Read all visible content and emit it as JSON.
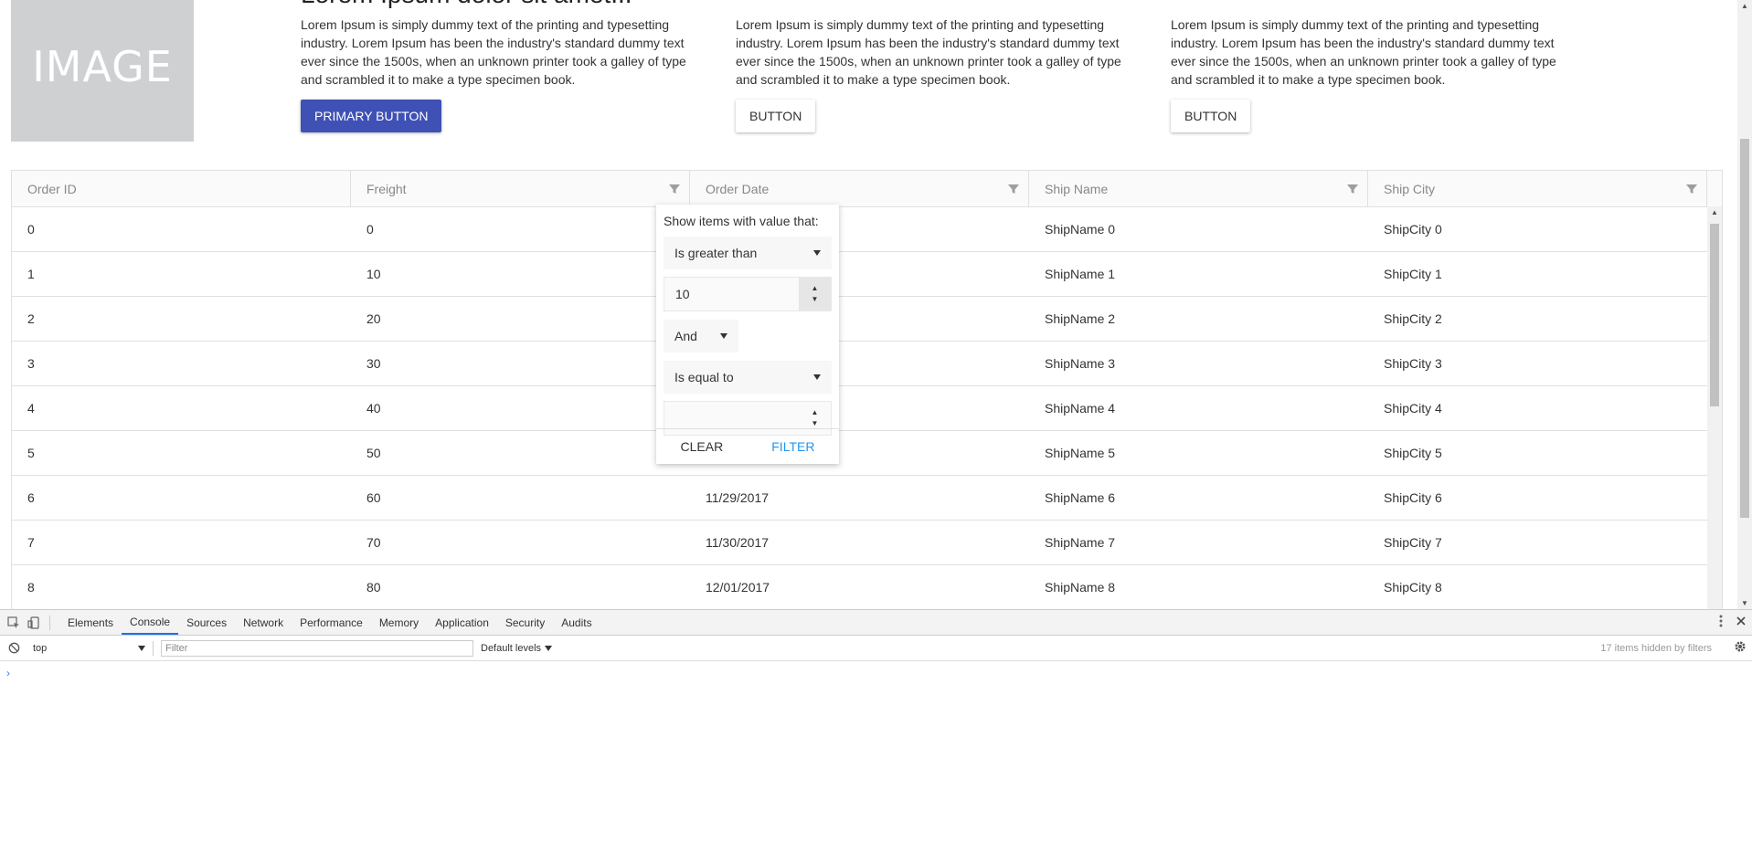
{
  "hero": {
    "image_placeholder": "IMAGE",
    "title": "Lorem Ipsum dolor sit amet...",
    "cards": [
      {
        "text": "Lorem Ipsum is simply dummy text of the printing and typesetting industry. Lorem Ipsum has been the industry's standard dummy text ever since the 1500s, when an unknown printer took a galley of type and scrambled it to make a type specimen book.",
        "button": "PRIMARY BUTTON"
      },
      {
        "text": "Lorem Ipsum is simply dummy text of the printing and typesetting industry. Lorem Ipsum has been the industry's standard dummy text ever since the 1500s, when an unknown printer took a galley of type and scrambled it to make a type specimen book.",
        "button": "BUTTON"
      },
      {
        "text": "Lorem Ipsum is simply dummy text of the printing and typesetting industry. Lorem Ipsum has been the industry's standard dummy text ever since the 1500s, when an unknown printer took a galley of type and scrambled it to make a type specimen book.",
        "button": "BUTTON"
      }
    ]
  },
  "grid": {
    "columns": [
      "Order ID",
      "Freight",
      "Order Date",
      "Ship Name",
      "Ship City"
    ],
    "rows": [
      [
        "0",
        "0",
        "",
        "ShipName 0",
        "ShipCity 0"
      ],
      [
        "1",
        "10",
        "",
        "ShipName 1",
        "ShipCity 1"
      ],
      [
        "2",
        "20",
        "",
        "ShipName 2",
        "ShipCity 2"
      ],
      [
        "3",
        "30",
        "",
        "ShipName 3",
        "ShipCity 3"
      ],
      [
        "4",
        "40",
        "",
        "ShipName 4",
        "ShipCity 4"
      ],
      [
        "5",
        "50",
        "",
        "ShipName 5",
        "ShipCity 5"
      ],
      [
        "6",
        "60",
        "11/29/2017",
        "ShipName 6",
        "ShipCity 6"
      ],
      [
        "7",
        "70",
        "11/30/2017",
        "ShipName 7",
        "ShipCity 7"
      ],
      [
        "8",
        "80",
        "12/01/2017",
        "ShipName 8",
        "ShipCity 8"
      ]
    ]
  },
  "filter_menu": {
    "label": "Show items with value that:",
    "operator1": "Is greater than",
    "value1": "10",
    "logic": "And",
    "operator2": "Is equal to",
    "value2": "",
    "clear_label": "CLEAR",
    "filter_label": "FILTER"
  },
  "devtools": {
    "tabs": [
      "Elements",
      "Console",
      "Sources",
      "Network",
      "Performance",
      "Memory",
      "Application",
      "Security",
      "Audits"
    ],
    "active_tab": "Console",
    "context": "top",
    "filter_placeholder": "Filter",
    "levels": "Default levels",
    "hidden_count": "17 items hidden by filters",
    "prompt": "›"
  },
  "colors": {
    "primary": "#3f51b5",
    "filter_link": "#2196f3",
    "devtools_accent": "#1a73e8"
  }
}
